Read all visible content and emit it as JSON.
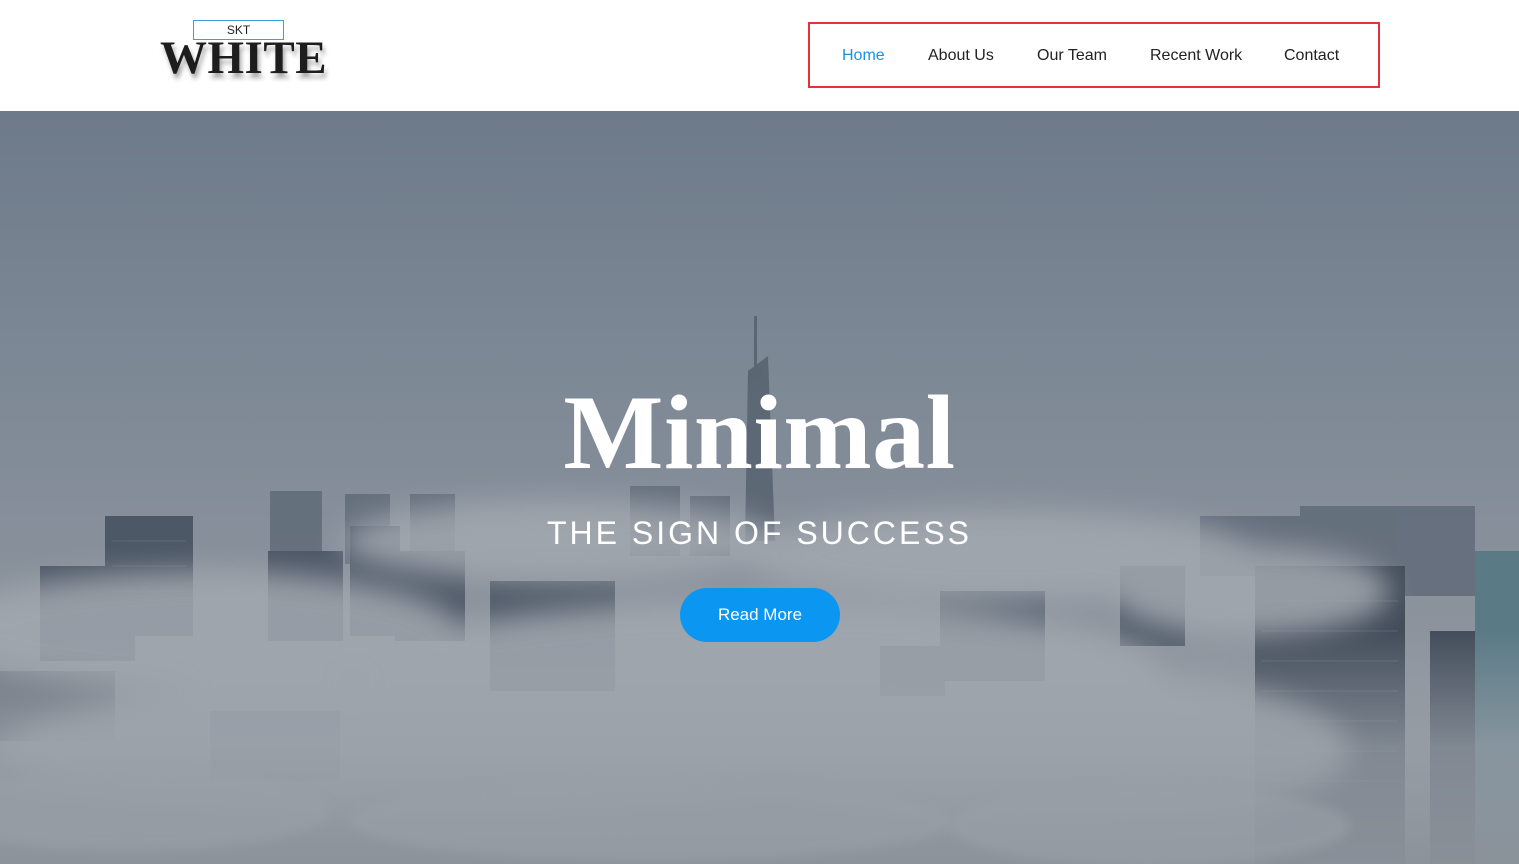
{
  "logo": {
    "tag": "SKT",
    "word": "WHITE"
  },
  "nav": {
    "items": [
      {
        "label": "Home",
        "active": true
      },
      {
        "label": "About Us",
        "active": false
      },
      {
        "label": "Our Team",
        "active": false
      },
      {
        "label": "Recent Work",
        "active": false
      },
      {
        "label": "Contact",
        "active": false
      }
    ]
  },
  "hero": {
    "title": "Minimal",
    "subtitle": "THE SIGN OF SUCCESS",
    "button_label": "Read More"
  },
  "colors": {
    "accent": "#0b96f2",
    "nav_active": "#1e90e0",
    "nav_highlight_border": "#e53238",
    "nav_text": "#222222"
  }
}
